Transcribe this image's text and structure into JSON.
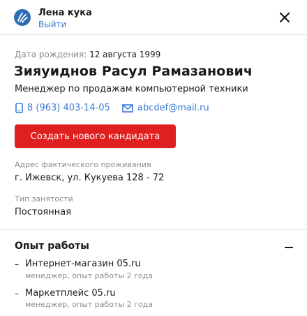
{
  "header": {
    "user_name": "Лена кука",
    "logout_label": "Выйти"
  },
  "candidate": {
    "birth_label": "Дата рождения:",
    "birth_date": "12 августа 1999",
    "full_name": "Зияуиднов Расул Рамазанович",
    "position": "Менеджер по продажам компьютерной техники",
    "phone": "8 (963) 403-14-05",
    "email": "abcdef@mail.ru",
    "create_button_label": "Создать нового кандидата",
    "address_label": "Адрес фактического проживания",
    "address_value": "г. Ижевск, ул. Кукуева 128 - 72",
    "employment_label": "Тип занятости",
    "employment_value": "Постоянная"
  },
  "experience": {
    "title": "Опыт работы",
    "bullet": "–",
    "jobs": [
      {
        "company": "Интернет-магазин 05.ru",
        "meta": "менеджер, опыт работы 2 года"
      },
      {
        "company": "Маркетплейс 05.ru",
        "meta": "менеджер, опыт работы 2 года"
      }
    ]
  },
  "icons": {
    "logo": "hand-wave-logo-icon",
    "close": "close-icon",
    "phone": "phone-icon",
    "email": "envelope-icon",
    "collapse": "minus-icon"
  },
  "colors": {
    "accent_red": "#e02020",
    "link_blue": "#3a7bd5",
    "logo_blue": "#2e6db4"
  }
}
